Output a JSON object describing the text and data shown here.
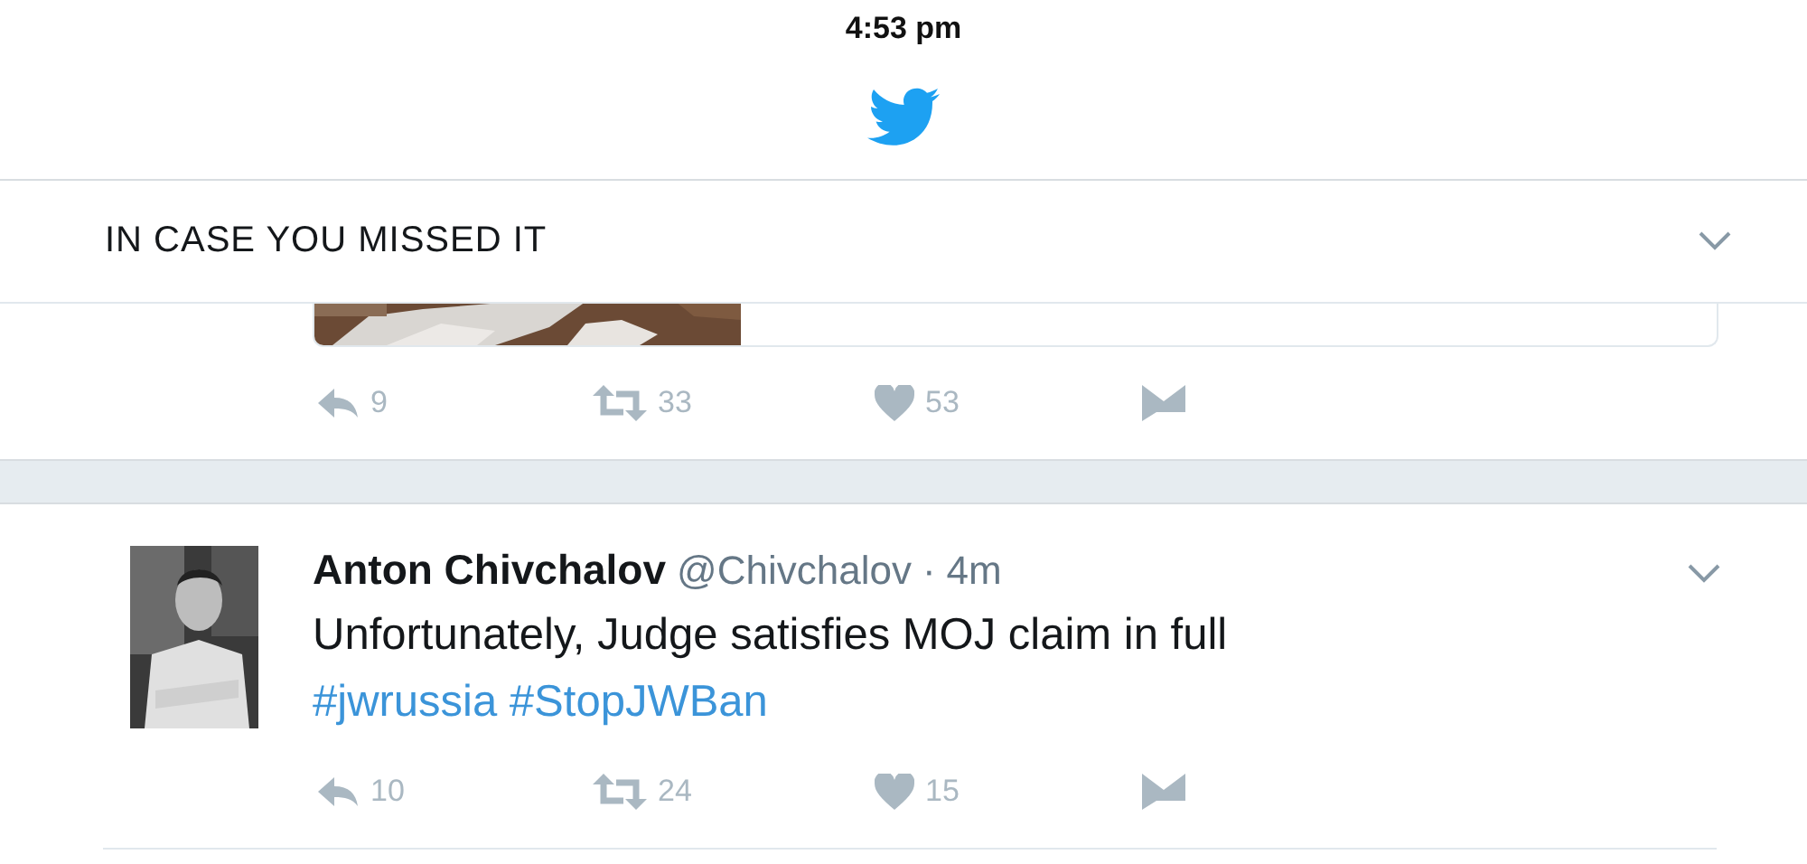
{
  "status_bar": {
    "time": "4:53 pm"
  },
  "header": {
    "title": "IN CASE YOU MISSED IT"
  },
  "previous_tweet": {
    "actions": [
      {
        "kind": "reply",
        "count": "9"
      },
      {
        "kind": "retweet",
        "count": "33"
      },
      {
        "kind": "like",
        "count": "53"
      },
      {
        "kind": "message"
      }
    ]
  },
  "tweet": {
    "name": "Anton Chivchalov",
    "handle": "@Chivchalov",
    "separator": "·",
    "time": "4m",
    "text": [
      {
        "kind": "text",
        "text": "Unfortunately, Judge satisfies MOJ claim in full "
      },
      {
        "kind": "hashtag",
        "text": "#jwrussia"
      },
      {
        "kind": "hashtag",
        "text": " #StopJWBan"
      }
    ],
    "actions": [
      {
        "kind": "reply",
        "count": "10"
      },
      {
        "kind": "retweet",
        "count": "24"
      },
      {
        "kind": "like",
        "count": "15"
      },
      {
        "kind": "message"
      }
    ]
  }
}
